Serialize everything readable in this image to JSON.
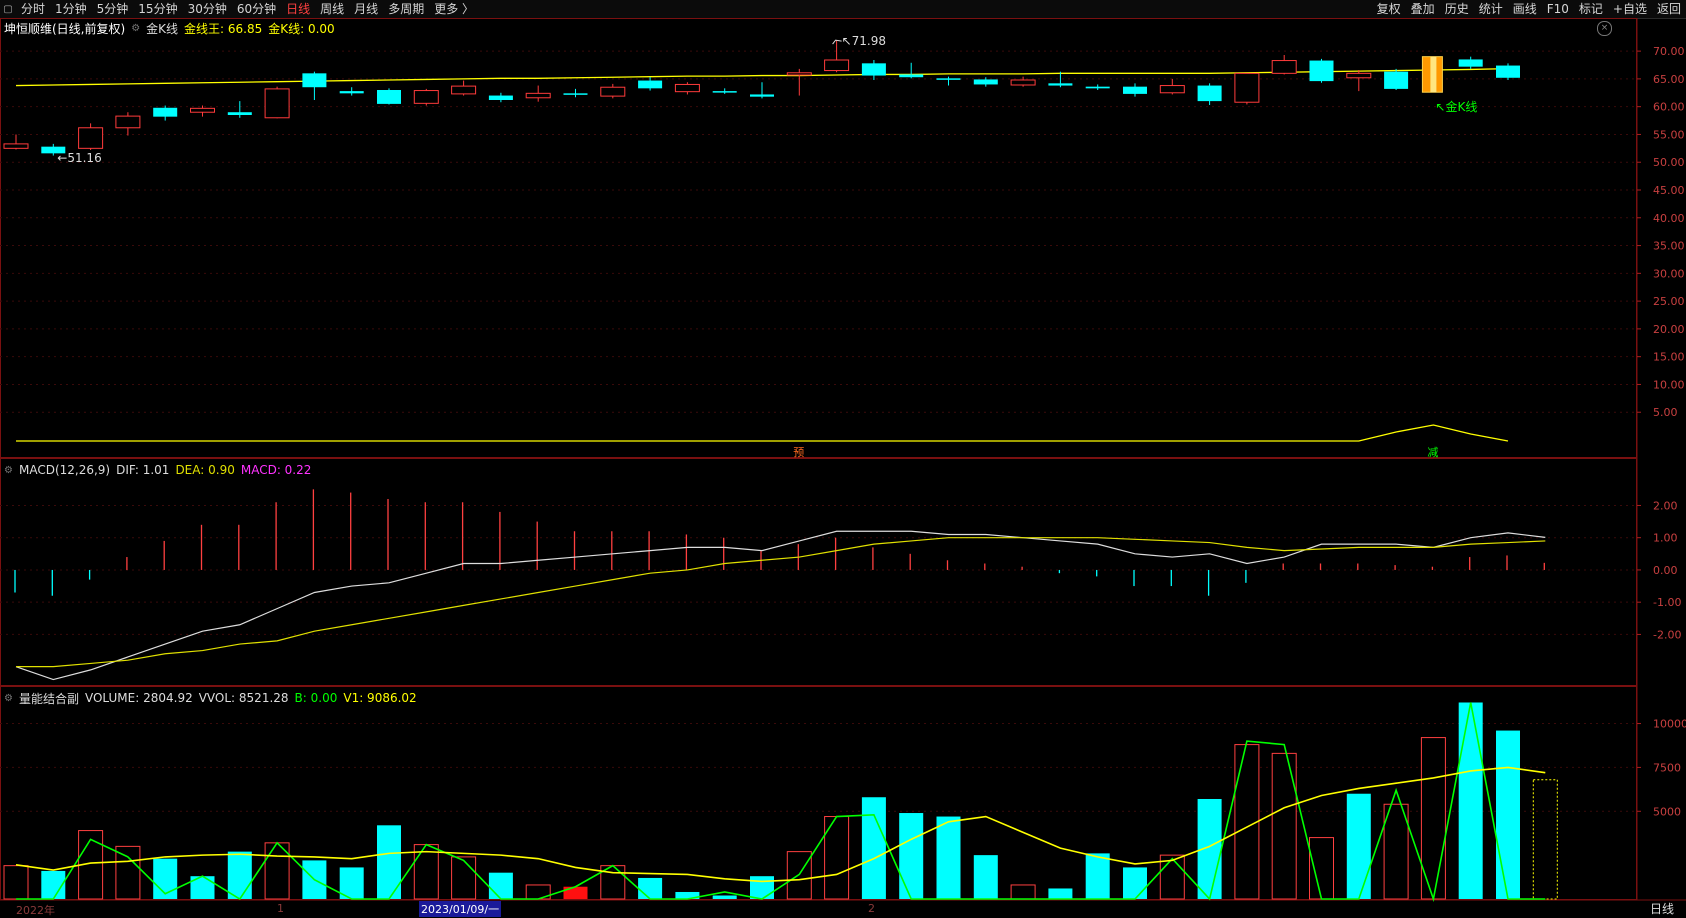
{
  "toolbar": {
    "left": [
      "分时",
      "1分钟",
      "5分钟",
      "15分钟",
      "30分钟",
      "60分钟",
      "日线",
      "周线",
      "月线",
      "多周期",
      "更多 〉"
    ],
    "active": "日线",
    "right": [
      "复权",
      "叠加",
      "历史",
      "统计",
      "画线",
      "F10",
      "标记",
      "+自选",
      "返回"
    ]
  },
  "main_panel": {
    "title": "坤恒顺维(日线,前复权)",
    "indicator": "金K线",
    "l1": "金线王: 66.85",
    "l2": "金K线: 0.00",
    "price_axis": [
      "70.00",
      "65.00",
      "60.00",
      "55.00",
      "50.00",
      "45.00",
      "40.00",
      "35.00",
      "30.00",
      "25.00",
      "20.00",
      "15.00",
      "10.00",
      "5.00"
    ],
    "max_label": "71.98",
    "min_label": "51.16",
    "gold_tag": "金K线",
    "mark_yu": "预",
    "mark_jian": "减"
  },
  "macd_panel": {
    "title": "MACD(12,26,9)",
    "dif": "DIF: 1.01",
    "dea": "DEA: 0.90",
    "macd": "MACD: 0.22",
    "axis": [
      "2.00",
      "1.00",
      "0.00",
      "-1.00",
      "-2.00"
    ]
  },
  "vol_panel": {
    "title": "量能结合副",
    "volume": "VOLUME: 2804.92",
    "vvol": "VVOL: 8521.28",
    "b": "B: 0.00",
    "v1": "V1: 9086.02",
    "axis": [
      "10000",
      "7500",
      "5000"
    ]
  },
  "date_axis": {
    "year": "2022年",
    "m1": "1",
    "selected": "2023/01/09/一",
    "m2": "2",
    "period_tag": "日线"
  },
  "colors": {
    "up": "#ff3b3b",
    "down": "#00ffff",
    "ma": "#ffff00",
    "dif": "#dddddd",
    "dea": "#e0e000",
    "vol_line": "#00ff00"
  },
  "chart_data": [
    {
      "type": "candlestick",
      "title": "坤恒顺维(日线,前复权)",
      "ylim": [
        0,
        72
      ],
      "candles": [
        {
          "o": 52.5,
          "c": 53.3,
          "h": 55.0,
          "l": 52.3
        },
        {
          "o": 52.8,
          "c": 51.6,
          "h": 53.3,
          "l": 51.2
        },
        {
          "o": 52.5,
          "c": 56.2,
          "h": 57.0,
          "l": 52.2
        },
        {
          "o": 56.2,
          "c": 58.3,
          "h": 59.0,
          "l": 54.8
        },
        {
          "o": 59.8,
          "c": 58.2,
          "h": 60.2,
          "l": 57.5
        },
        {
          "o": 59.0,
          "c": 59.7,
          "h": 60.2,
          "l": 58.2
        },
        {
          "o": 59.0,
          "c": 58.5,
          "h": 61.0,
          "l": 58.0
        },
        {
          "o": 58.0,
          "c": 63.2,
          "h": 63.6,
          "l": 57.9
        },
        {
          "o": 66.0,
          "c": 63.5,
          "h": 66.3,
          "l": 61.2
        },
        {
          "o": 62.8,
          "c": 62.4,
          "h": 63.5,
          "l": 62.0
        },
        {
          "o": 63.0,
          "c": 60.5,
          "h": 63.3,
          "l": 60.4
        },
        {
          "o": 60.6,
          "c": 62.9,
          "h": 63.2,
          "l": 60.2
        },
        {
          "o": 62.3,
          "c": 63.7,
          "h": 64.7,
          "l": 62.0
        },
        {
          "o": 62.0,
          "c": 61.2,
          "h": 62.5,
          "l": 60.8
        },
        {
          "o": 61.6,
          "c": 62.4,
          "h": 63.8,
          "l": 60.9
        },
        {
          "o": 62.4,
          "c": 62.2,
          "h": 63.2,
          "l": 61.7
        },
        {
          "o": 61.9,
          "c": 63.5,
          "h": 64.1,
          "l": 61.5
        },
        {
          "o": 64.7,
          "c": 63.3,
          "h": 65.3,
          "l": 62.9
        },
        {
          "o": 62.7,
          "c": 64.0,
          "h": 64.4,
          "l": 62.2
        },
        {
          "o": 62.8,
          "c": 62.6,
          "h": 63.3,
          "l": 62.3
        },
        {
          "o": 62.2,
          "c": 61.8,
          "h": 64.4,
          "l": 61.5
        },
        {
          "o": 65.7,
          "c": 66.1,
          "h": 66.8,
          "l": 62.0
        },
        {
          "o": 66.5,
          "c": 68.4,
          "h": 71.98,
          "l": 66.2
        },
        {
          "o": 67.8,
          "c": 65.6,
          "h": 68.4,
          "l": 64.8
        },
        {
          "o": 65.8,
          "c": 65.3,
          "h": 67.9,
          "l": 65.1
        },
        {
          "o": 65.1,
          "c": 65.0,
          "h": 65.4,
          "l": 63.8
        },
        {
          "o": 64.9,
          "c": 64.0,
          "h": 65.3,
          "l": 63.6
        },
        {
          "o": 63.9,
          "c": 64.8,
          "h": 65.4,
          "l": 63.6
        },
        {
          "o": 64.2,
          "c": 63.8,
          "h": 66.3,
          "l": 63.5
        },
        {
          "o": 63.6,
          "c": 63.3,
          "h": 64.0,
          "l": 63.0
        },
        {
          "o": 63.6,
          "c": 62.3,
          "h": 64.2,
          "l": 61.8
        },
        {
          "o": 62.5,
          "c": 63.8,
          "h": 65.0,
          "l": 62.2
        },
        {
          "o": 63.8,
          "c": 61.0,
          "h": 64.2,
          "l": 60.3
        },
        {
          "o": 60.8,
          "c": 66.0,
          "h": 66.0,
          "l": 60.4
        },
        {
          "o": 66.0,
          "c": 68.3,
          "h": 69.3,
          "l": 65.8
        },
        {
          "o": 68.3,
          "c": 64.6,
          "h": 68.6,
          "l": 64.3
        },
        {
          "o": 65.2,
          "c": 66.0,
          "h": 66.6,
          "l": 62.8
        },
        {
          "o": 66.3,
          "c": 63.2,
          "h": 66.8,
          "l": 63.0
        },
        {
          "o": 63.4,
          "c": 68.5,
          "h": 68.9,
          "l": 63.2
        },
        {
          "o": 68.5,
          "c": 67.2,
          "h": 69.0,
          "l": 66.8
        },
        {
          "o": 67.4,
          "c": 65.2,
          "h": 67.8,
          "l": 64.8
        }
      ],
      "ma": [
        63.8,
        63.9,
        64.0,
        64.1,
        64.2,
        64.3,
        64.4,
        64.5,
        64.6,
        64.7,
        64.8,
        64.9,
        65.0,
        65.1,
        65.1,
        65.2,
        65.3,
        65.4,
        65.5,
        65.5,
        65.6,
        65.6,
        65.7,
        65.8,
        65.8,
        65.9,
        65.9,
        65.9,
        66.0,
        66.0,
        66.0,
        66.0,
        66.0,
        66.1,
        66.2,
        66.3,
        66.4,
        66.5,
        66.6,
        66.7,
        66.85
      ],
      "gold_k_index": 38,
      "baseline": [
        0,
        0,
        0,
        0,
        0,
        0,
        0,
        0,
        0,
        0,
        0,
        0,
        0,
        0,
        0,
        0,
        0,
        0,
        0,
        0,
        0,
        0,
        0,
        0,
        0,
        0,
        0,
        0,
        0,
        0,
        0,
        0,
        0,
        0,
        0,
        0,
        0,
        0.9,
        1.6,
        0.7,
        0.0
      ]
    },
    {
      "type": "macd",
      "ylim": [
        -3.6,
        3.1
      ],
      "dif": [
        -3.0,
        -3.4,
        -3.1,
        -2.7,
        -2.3,
        -1.9,
        -1.7,
        -1.2,
        -0.7,
        -0.5,
        -0.4,
        -0.1,
        0.2,
        0.2,
        0.3,
        0.4,
        0.5,
        0.6,
        0.7,
        0.7,
        0.6,
        0.9,
        1.2,
        1.2,
        1.2,
        1.1,
        1.1,
        1.0,
        0.9,
        0.8,
        0.5,
        0.4,
        0.5,
        0.2,
        0.4,
        0.8,
        0.8,
        0.8,
        0.7,
        1.0,
        1.15,
        1.01
      ],
      "dea": [
        -3.0,
        -3.0,
        -2.9,
        -2.8,
        -2.6,
        -2.5,
        -2.3,
        -2.2,
        -1.9,
        -1.7,
        -1.5,
        -1.3,
        -1.1,
        -0.9,
        -0.7,
        -0.5,
        -0.3,
        -0.1,
        0.0,
        0.2,
        0.3,
        0.4,
        0.6,
        0.8,
        0.9,
        1.0,
        1.0,
        1.0,
        1.0,
        1.0,
        0.95,
        0.9,
        0.85,
        0.7,
        0.6,
        0.65,
        0.7,
        0.7,
        0.7,
        0.8,
        0.85,
        0.9
      ],
      "macd": [
        -0.7,
        -0.8,
        -0.3,
        0.4,
        0.9,
        1.4,
        1.4,
        2.1,
        2.5,
        2.4,
        2.2,
        2.1,
        2.1,
        1.8,
        1.5,
        1.2,
        1.2,
        1.2,
        1.1,
        1.0,
        0.6,
        0.8,
        1.0,
        0.7,
        0.5,
        0.3,
        0.2,
        0.1,
        -0.1,
        -0.2,
        -0.5,
        -0.5,
        -0.8,
        -0.4,
        0.2,
        0.2,
        0.2,
        0.15,
        0.1,
        0.4,
        0.45,
        0.22
      ]
    },
    {
      "type": "bar",
      "ylim": [
        0,
        11000
      ],
      "volume_up": [
        true,
        false,
        true,
        true,
        false,
        false,
        false,
        true,
        false,
        false,
        false,
        true,
        true,
        false,
        true,
        false,
        true,
        false,
        false,
        false,
        false,
        true,
        true,
        false,
        false,
        false,
        false,
        true,
        false,
        false,
        false,
        true,
        false,
        true,
        true,
        true,
        false,
        true,
        true,
        false,
        false
      ],
      "volume": [
        1900,
        1600,
        3900,
        3000,
        2300,
        1300,
        2700,
        3200,
        2200,
        1800,
        4200,
        3100,
        2400,
        1500,
        800,
        700,
        1900,
        1200,
        400,
        200,
        1300,
        2700,
        4700,
        5800,
        4900,
        4700,
        2500,
        800,
        600,
        2600,
        1800,
        2500,
        5700,
        8800,
        8300,
        3500,
        6000,
        5400,
        9200,
        11200,
        9600
      ],
      "volume_hollow_last": 6800,
      "ma": [
        1950,
        1650,
        2050,
        2150,
        2400,
        2500,
        2550,
        2450,
        2400,
        2300,
        2600,
        2700,
        2600,
        2500,
        2300,
        1800,
        1500,
        1450,
        1400,
        1150,
        1000,
        1100,
        1400,
        2300,
        3400,
        4400,
        4700,
        3800,
        2900,
        2400,
        2000,
        2200,
        3000,
        4100,
        5200,
        5900,
        6300,
        6600,
        6900,
        7300,
        7500,
        7200
      ],
      "v1": [
        0,
        0,
        3400,
        2400,
        300,
        1300,
        0,
        3200,
        1100,
        0,
        0,
        3100,
        2200,
        0,
        0,
        700,
        1900,
        0,
        0,
        400,
        0,
        1400,
        4700,
        4800,
        0,
        0,
        0,
        0,
        0,
        0,
        0,
        2300,
        0,
        9000,
        8800,
        0,
        0,
        6200,
        0,
        11200,
        0,
        0
      ]
    }
  ]
}
